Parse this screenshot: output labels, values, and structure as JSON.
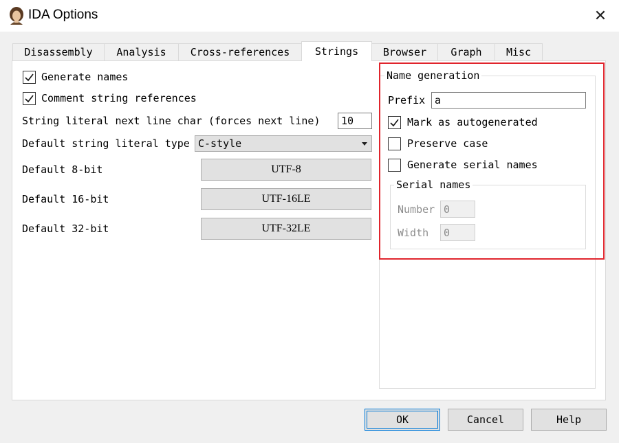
{
  "window": {
    "title": "IDA Options",
    "close_glyph": "✕"
  },
  "tabs": [
    {
      "label": "Disassembly",
      "active": false
    },
    {
      "label": "Analysis",
      "active": false
    },
    {
      "label": "Cross-references",
      "active": false
    },
    {
      "label": "Strings",
      "active": true
    },
    {
      "label": "Browser",
      "active": false
    },
    {
      "label": "Graph",
      "active": false
    },
    {
      "label": "Misc",
      "active": false
    }
  ],
  "left": {
    "generate_names": {
      "label": "Generate names",
      "checked": true
    },
    "comment_refs": {
      "label": "Comment string references",
      "checked": true
    },
    "next_line_char": {
      "label": "String literal next line char (forces next line)",
      "value": "10"
    },
    "default_type": {
      "label": "Default string literal type",
      "value": "C-style"
    },
    "bit8": {
      "label": "Default 8-bit",
      "value": "UTF-8"
    },
    "bit16": {
      "label": "Default 16-bit",
      "value": "UTF-16LE"
    },
    "bit32": {
      "label": "Default 32-bit",
      "value": "UTF-32LE"
    }
  },
  "name_generation": {
    "title": "Name generation",
    "prefix_label": "Prefix",
    "prefix_value": "a",
    "mark_autogen": {
      "label": "Mark as autogenerated",
      "checked": true
    },
    "preserve_case": {
      "label": "Preserve case",
      "checked": false
    },
    "serial_names": {
      "label": "Generate serial names",
      "checked": false
    },
    "serial_group": {
      "title": "Serial names",
      "number_label": "Number",
      "number_value": "0",
      "width_label": "Width",
      "width_value": "0"
    }
  },
  "buttons": {
    "ok": "OK",
    "cancel": "Cancel",
    "help": "Help"
  },
  "colors": {
    "highlight": "#e0242c",
    "accent": "#0078d7"
  }
}
